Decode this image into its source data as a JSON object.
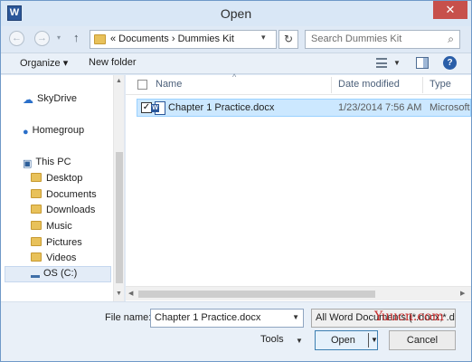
{
  "window": {
    "title": "Open",
    "app_icon_letter": "W",
    "close_glyph": "✕"
  },
  "navigation": {
    "back_glyph": "←",
    "forward_glyph": "→",
    "up_glyph": "↑",
    "address_path": "«  Documents  ›  Dummies Kit",
    "search_placeholder": "Search Dummies Kit"
  },
  "toolbar": {
    "organize_label": "Organize ▾",
    "new_folder_label": "New folder",
    "help_glyph": "?"
  },
  "nav_pane": {
    "items": [
      {
        "label": "SkyDrive",
        "icon": "cloud-icon"
      },
      {
        "label": "Homegroup",
        "icon": "homegroup-icon"
      },
      {
        "label": "This PC",
        "icon": "computer-icon"
      },
      {
        "label": "Desktop",
        "icon": "folder-icon"
      },
      {
        "label": "Documents",
        "icon": "folder-icon"
      },
      {
        "label": "Downloads",
        "icon": "folder-icon"
      },
      {
        "label": "Music",
        "icon": "folder-icon"
      },
      {
        "label": "Pictures",
        "icon": "folder-icon"
      },
      {
        "label": "Videos",
        "icon": "folder-icon"
      },
      {
        "label": "OS (C:)",
        "icon": "drive-icon"
      }
    ]
  },
  "file_list": {
    "columns": [
      "Name",
      "Date modified",
      "Type"
    ],
    "rows": [
      {
        "name": "Chapter 1 Practice.docx",
        "date_modified": "1/23/2014 7:56 AM",
        "type": "Microsoft",
        "checked": true
      }
    ]
  },
  "bottom": {
    "file_name_label": "File name:",
    "file_name_value": "Chapter 1 Practice.docx",
    "filter_value": "All Word Documents (*.docx;*.docm",
    "tools_label": "Tools",
    "open_label": "Open",
    "cancel_label": "Cancel",
    "watermark": "Yuucn.com"
  },
  "colors": {
    "selection": "#cce8ff",
    "close_button": "#c7504b",
    "frame": "#dfe9f5"
  }
}
